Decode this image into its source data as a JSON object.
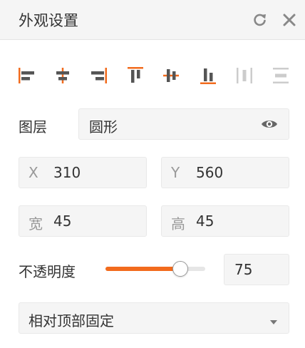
{
  "header": {
    "title": "外观设置",
    "refresh_icon": "refresh-icon",
    "close_icon": "close-icon"
  },
  "align_tools": [
    {
      "name": "align-left-icon",
      "active": true
    },
    {
      "name": "align-center-horizontal-icon",
      "active": true
    },
    {
      "name": "align-right-icon",
      "active": true
    },
    {
      "name": "align-top-icon",
      "active": true
    },
    {
      "name": "align-center-vertical-icon",
      "active": true
    },
    {
      "name": "align-bottom-icon",
      "active": true
    },
    {
      "name": "distribute-horizontal-icon",
      "active": false
    },
    {
      "name": "distribute-vertical-icon",
      "active": false
    }
  ],
  "layer": {
    "label": "图层",
    "value": "圆形",
    "visibility_icon": "eye-icon"
  },
  "position": {
    "x_label": "X",
    "x_value": "310",
    "y_label": "Y",
    "y_value": "560"
  },
  "size": {
    "width_label": "宽",
    "width_value": "45",
    "height_label": "高",
    "height_value": "45"
  },
  "opacity": {
    "label": "不透明度",
    "value": "75",
    "level": 0.75
  },
  "anchor": {
    "selected": "相对顶部固定",
    "dropdown_icon": "caret-down-icon"
  },
  "colors": {
    "accent": "#f26b1d",
    "icon_dark": "#555555",
    "icon_disabled": "#cccccc",
    "field_bg": "#f5f5f5"
  }
}
